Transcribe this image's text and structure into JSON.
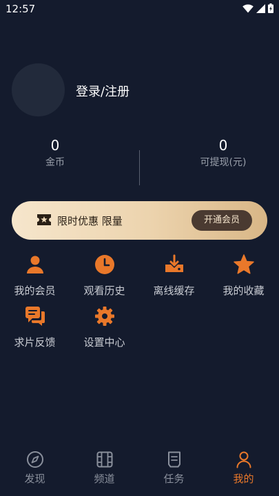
{
  "status_bar": {
    "time": "12:57"
  },
  "profile": {
    "login_label": "登录/注册"
  },
  "stats": [
    {
      "value": "0",
      "label": "金币"
    },
    {
      "value": "0",
      "label": "可提现(元)"
    }
  ],
  "vip": {
    "text": "限时优惠 限量",
    "button_label": "开通会员"
  },
  "menu": [
    {
      "label": "我的会员",
      "icon": "user-icon"
    },
    {
      "label": "观看历史",
      "icon": "clock-icon"
    },
    {
      "label": "离线缓存",
      "icon": "download-icon"
    },
    {
      "label": "我的收藏",
      "icon": "star-icon"
    },
    {
      "label": "求片反馈",
      "icon": "chat-icon"
    },
    {
      "label": "设置中心",
      "icon": "gear-icon"
    }
  ],
  "nav": [
    {
      "label": "发现",
      "icon": "compass-icon",
      "active": false
    },
    {
      "label": "频道",
      "icon": "film-icon",
      "active": false
    },
    {
      "label": "任务",
      "icon": "task-icon",
      "active": false
    },
    {
      "label": "我的",
      "icon": "person-icon",
      "active": true
    }
  ],
  "colors": {
    "background": "#141b2d",
    "accent": "#e9782a",
    "vip_gold": "#ecd3ad",
    "vip_button": "#4a3a31"
  }
}
